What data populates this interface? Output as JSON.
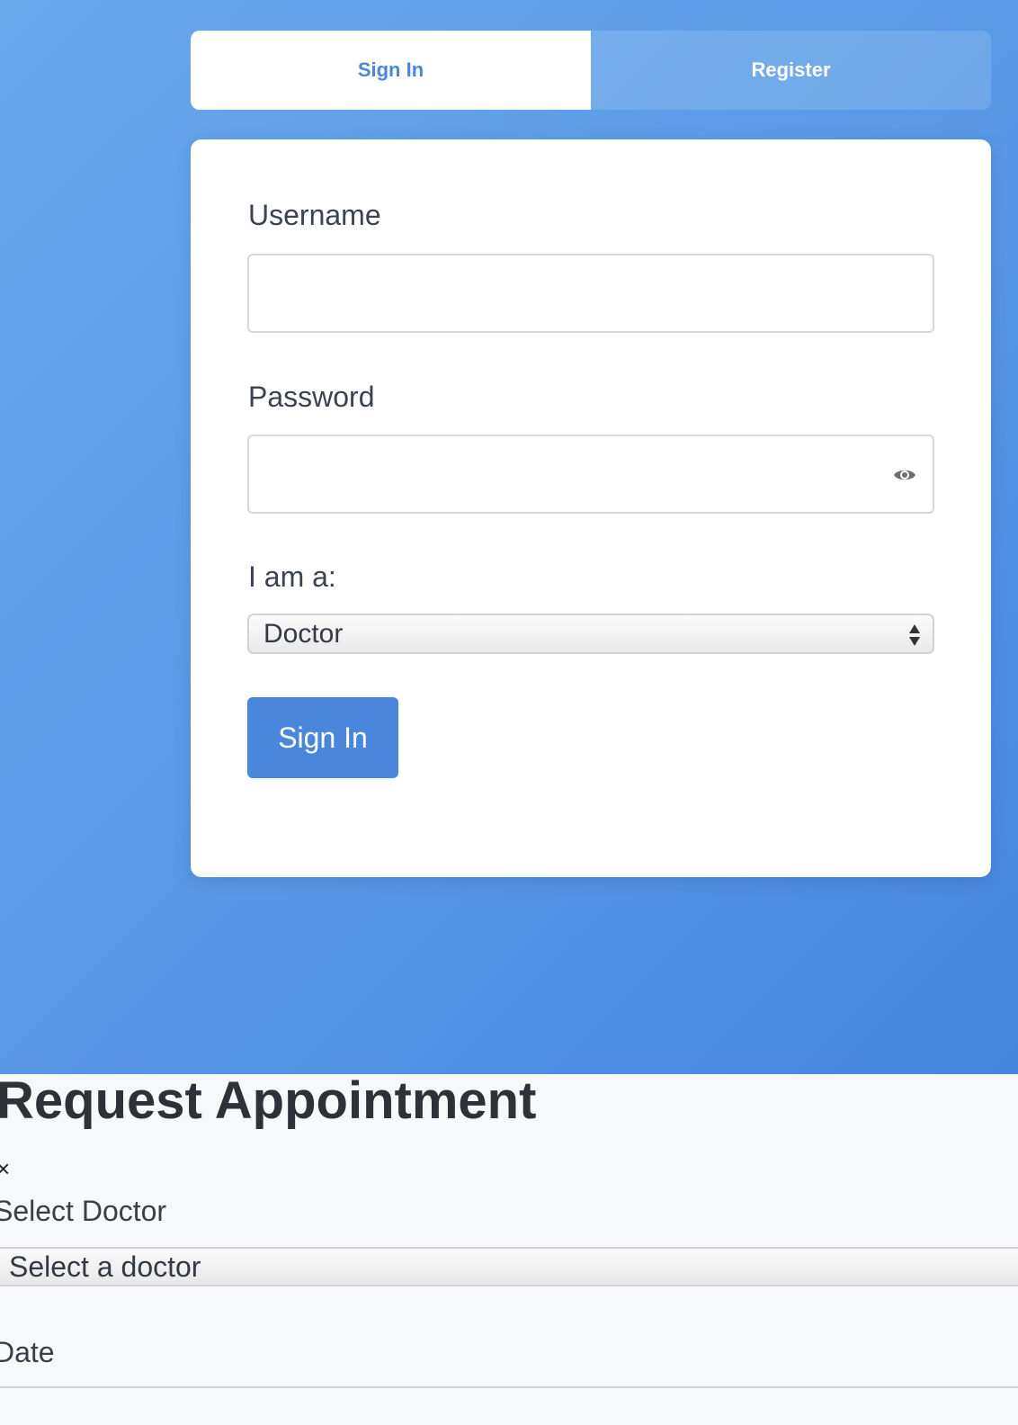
{
  "auth": {
    "tabs": [
      {
        "label": "Sign In",
        "active": true
      },
      {
        "label": "Register",
        "active": false
      }
    ],
    "username": {
      "label": "Username",
      "value": ""
    },
    "password": {
      "label": "Password",
      "value": "",
      "toggle_icon": "eye-icon"
    },
    "role": {
      "label": "I am a:",
      "selected": "Doctor"
    },
    "submit_label": "Sign In"
  },
  "appointment": {
    "title": "Request Appointment",
    "close_symbol": "×",
    "doctor": {
      "label": "Select Doctor",
      "selected": "Select a doctor"
    },
    "date": {
      "label": "Date"
    }
  },
  "colors": {
    "accent": "#4a87dc",
    "background_gradient_start": "#6aa8ec",
    "background_gradient_end": "#4586df"
  }
}
